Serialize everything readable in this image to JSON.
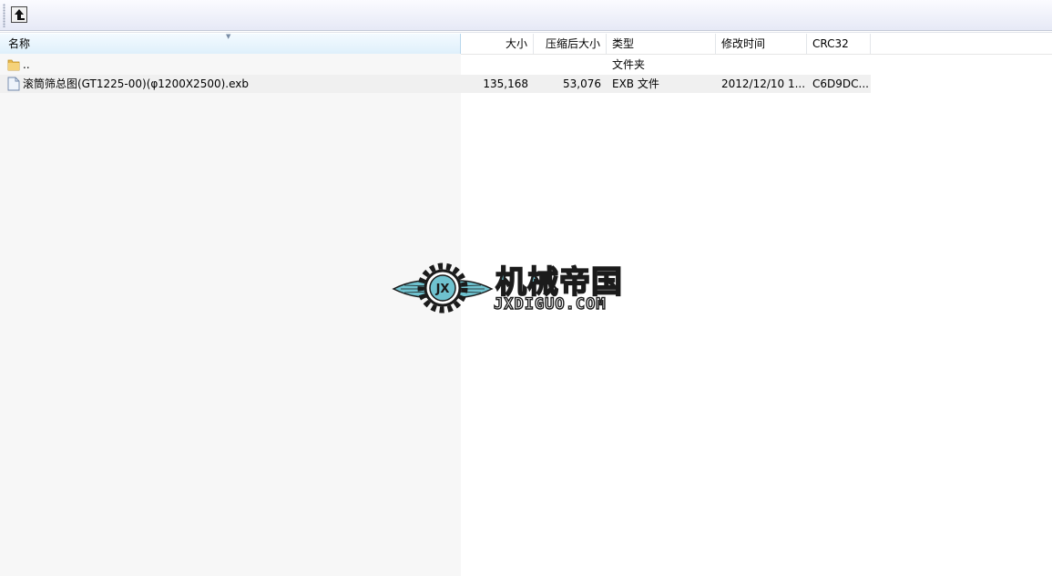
{
  "header": {
    "name": "名称",
    "size": "大小",
    "packed": "压缩后大小",
    "type": "类型",
    "modified": "修改时间",
    "crc": "CRC32"
  },
  "rows": [
    {
      "name": "..",
      "size": "",
      "packed": "",
      "type": "文件夹",
      "modified": "",
      "crc": "",
      "icon": "folder-icon"
    },
    {
      "name": "滚筒筛总图(GT1225-00)(φ1200X2500).exb",
      "size": "135,168",
      "packed": "53,076",
      "type": "EXB 文件",
      "modified": "2012/12/10 1...",
      "crc": "C6D9DC...",
      "icon": "file-icon"
    }
  ],
  "watermark": {
    "title": "机械帝国",
    "url": "JXDIGUO.COM",
    "badge": "JX"
  },
  "colors": {
    "accent": "#6fc2cf",
    "sorted_header": "#dff0fb"
  }
}
